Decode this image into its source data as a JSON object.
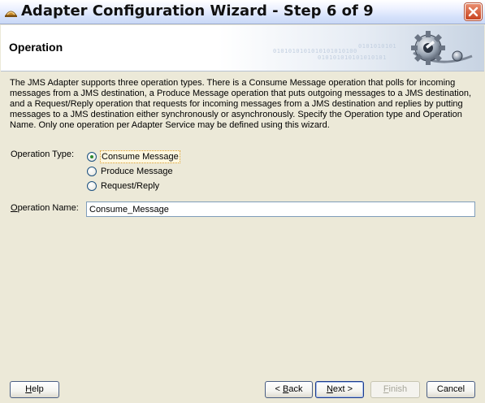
{
  "window": {
    "title": "Adapter Configuration Wizard - Step 6 of 9"
  },
  "header": {
    "title": "Operation",
    "binary_text": [
      "0101010101010101010100",
      "010101010101010101",
      "0101010101"
    ]
  },
  "description": "The JMS Adapter supports three operation types.  There is a Consume Message operation that polls for incoming messages from a JMS destination, a Produce Message operation that puts outgoing messages to a JMS destination, and a Request/Reply operation that requests for incoming messages from a JMS destination and replies by putting messages to a JMS destination either synchronously or asynchronously.  Specify the Operation type and Operation Name.  Only one operation per Adapter Service may be defined using this wizard.",
  "operation_type": {
    "label": "Operation Type:",
    "options": [
      "Consume Message",
      "Produce Message",
      "Request/Reply"
    ],
    "selected": "Consume Message"
  },
  "operation_name": {
    "label_underlined": "O",
    "label_rest": "peration Name:",
    "value": "Consume_Message"
  },
  "buttons": {
    "help_u": "H",
    "help_rest": "elp",
    "back_pre": "< ",
    "back_u": "B",
    "back_rest": "ack",
    "next_u": "N",
    "next_rest": "ext >",
    "finish_u": "F",
    "finish_rest": "inish",
    "cancel": "Cancel"
  },
  "colors": {
    "dialog_bg": "#ECE9D8",
    "close_button": "#C8431F",
    "radio_dot": "#2F8A2F"
  }
}
